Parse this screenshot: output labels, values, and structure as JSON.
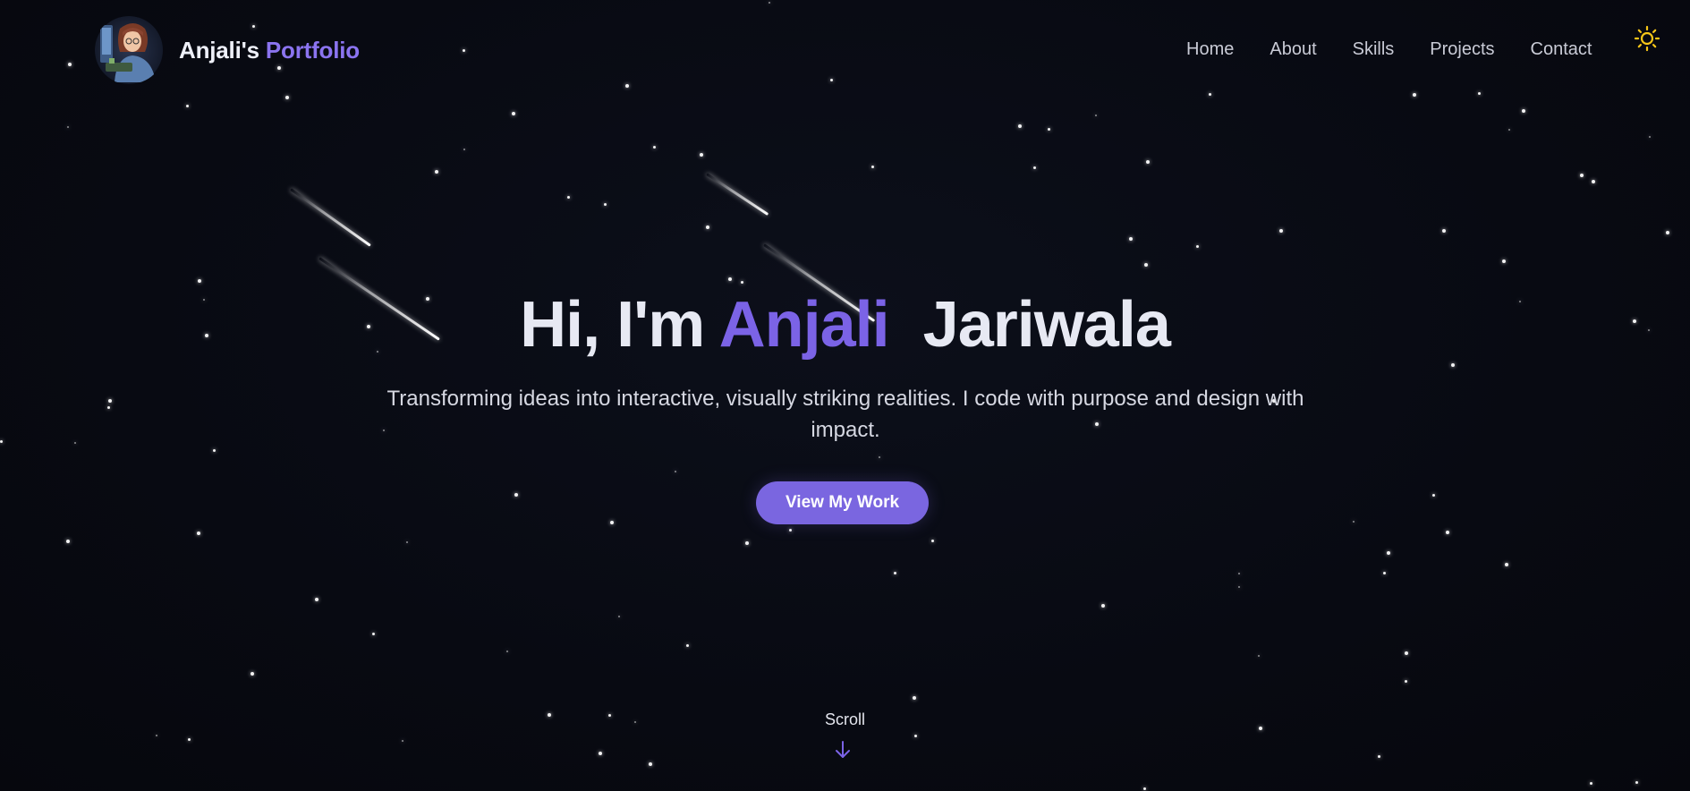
{
  "brand": {
    "name": "Anjali's",
    "accent": "Portfolio",
    "avatar_icon": "developer-avatar-icon"
  },
  "nav": {
    "items": [
      {
        "label": "Home"
      },
      {
        "label": "About"
      },
      {
        "label": "Skills"
      },
      {
        "label": "Projects"
      },
      {
        "label": "Contact"
      }
    ],
    "theme_toggle_icon": "sun-icon"
  },
  "hero": {
    "greeting": "Hi, I'm",
    "first_name": "Anjali",
    "last_name": "Jariwala",
    "tagline": "Transforming ideas into interactive, visually striking realities. I code with purpose and design with impact.",
    "cta_label": "View My Work"
  },
  "scroll": {
    "label": "Scroll",
    "icon": "arrow-down-icon"
  },
  "colors": {
    "background": "#080a12",
    "accent": "#7b63e6",
    "button": "#7a66e0",
    "sun": "#f5c518"
  }
}
